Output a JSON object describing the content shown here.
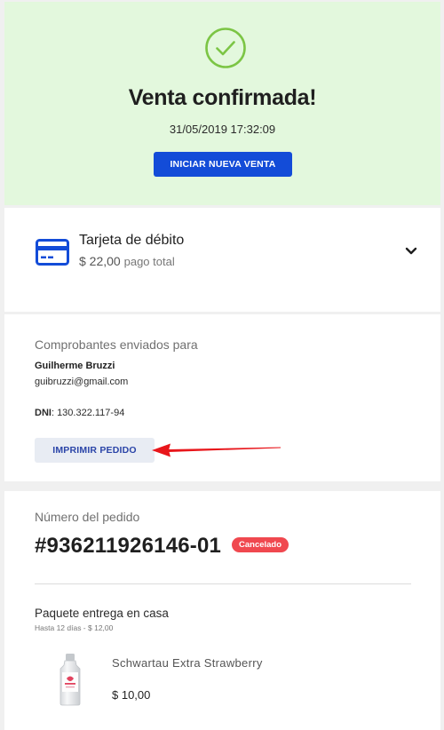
{
  "confirmation": {
    "title": "Venta confirmada!",
    "datetime": "31/05/2019 17:32:09",
    "new_sale_button": "INICIAR NUEVA VENTA",
    "icon": "check-circle-icon",
    "accent": "#7cc545",
    "background": "#e3f8dd"
  },
  "payment": {
    "method": "Tarjeta de débito",
    "amount": "$ 22,00",
    "amount_label": "pago total",
    "icon": "credit-card-icon",
    "expand_icon": "chevron-down-icon"
  },
  "receipts": {
    "heading": "Comprobantes enviados para",
    "customer_name": "Guilherme Bruzzi",
    "customer_email": "guibruzzi@gmail.com",
    "dni_label": "DNI",
    "dni_value": ": 130.322.117-94",
    "print_button": "IMPRIMIR PEDIDO"
  },
  "order": {
    "label": "Número del pedido",
    "number": "#936211926146-01",
    "status": "Cancelado",
    "status_color": "#f0484f",
    "package": {
      "title": "Paquete entrega en casa",
      "subtitle": "Hasta 12 días - $ 12,00"
    },
    "items": [
      {
        "name": "Schwartau Extra Strawberry",
        "price": "$ 10,00"
      }
    ]
  },
  "colors": {
    "primary": "#134cd8",
    "secondary_button_bg": "#e8ecf3",
    "annotation_arrow": "#e8161b"
  }
}
